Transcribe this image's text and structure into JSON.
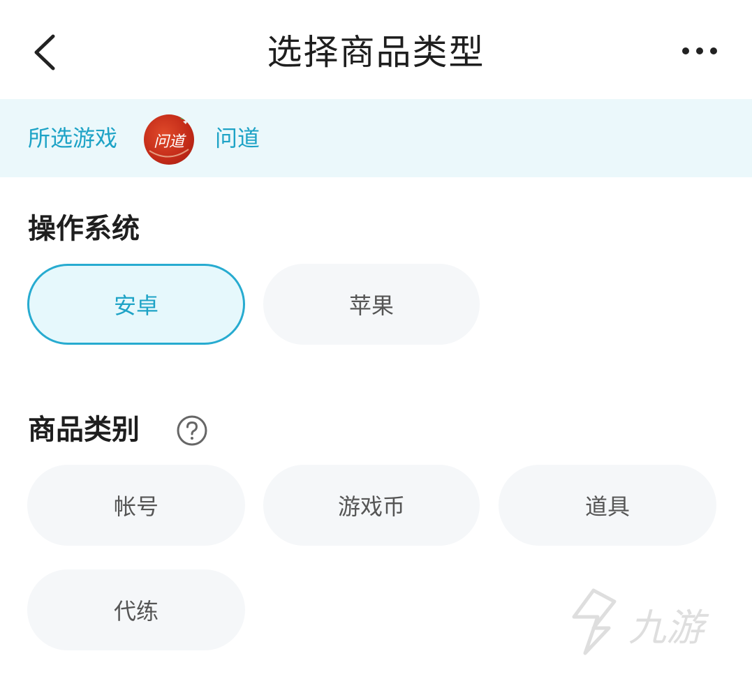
{
  "nav": {
    "title": "选择商品类型",
    "back_icon": "chevron-left-icon",
    "more_icon": "more-horizontal-icon"
  },
  "game_bar": {
    "label": "所选游戏",
    "game_name": "问道",
    "icon_text": "问道"
  },
  "os_section": {
    "title": "操作系统",
    "options": [
      {
        "label": "安卓",
        "selected": true
      },
      {
        "label": "苹果",
        "selected": false
      }
    ]
  },
  "category_section": {
    "title": "商品类别",
    "help_icon": "question-circle-icon",
    "options": [
      {
        "label": "帐号"
      },
      {
        "label": "游戏币"
      },
      {
        "label": "道具"
      },
      {
        "label": "代练"
      }
    ]
  },
  "watermark": {
    "text": "九游"
  },
  "colors": {
    "accent": "#1ea3c6",
    "accent_border": "#27abd0",
    "banner_bg": "#ebf8fb",
    "chip_bg": "#f5f7f9",
    "selected_bg": "#e6f8fc"
  }
}
